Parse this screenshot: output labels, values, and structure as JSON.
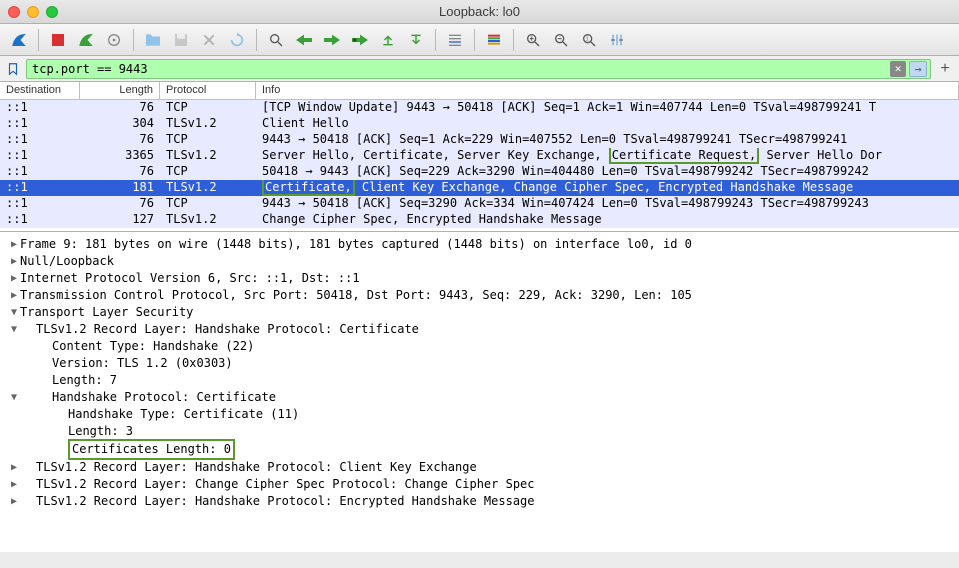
{
  "window": {
    "title": "Loopback: lo0"
  },
  "filter": {
    "value": "tcp.port == 9443"
  },
  "columns": {
    "dest": "Destination",
    "len": "Length",
    "proto": "Protocol",
    "info": "Info"
  },
  "packets": [
    {
      "dest": "::1",
      "len": "76",
      "proto": "TCP",
      "cls": "r-tcp",
      "info": "[TCP Window Update] 9443 → 50418 [ACK] Seq=1 Ack=1 Win=407744 Len=0 TSval=498799241 T"
    },
    {
      "dest": "::1",
      "len": "304",
      "proto": "TLSv1.2",
      "cls": "r-tls",
      "info": "Client Hello"
    },
    {
      "dest": "::1",
      "len": "76",
      "proto": "TCP",
      "cls": "r-tcp",
      "info": "9443 → 50418 [ACK] Seq=1 Ack=229 Win=407552 Len=0 TSval=498799241 TSecr=498799241"
    },
    {
      "dest": "::1",
      "len": "3365",
      "proto": "TLSv1.2",
      "cls": "r-tls",
      "info_parts": [
        "Server Hello, Certificate, Server Key Exchange, ",
        "Certificate Request,",
        " Server Hello Dor"
      ]
    },
    {
      "dest": "::1",
      "len": "76",
      "proto": "TCP",
      "cls": "r-tcp",
      "info": "50418 → 9443 [ACK] Seq=229 Ack=3290 Win=404480 Len=0 TSval=498799242 TSecr=498799242"
    },
    {
      "dest": "::1",
      "len": "181",
      "proto": "TLSv1.2",
      "cls": "r-sel",
      "info_parts": [
        "Certificate,",
        " Client Key Exchange, Change Cipher Spec, Encrypted Handshake Message"
      ]
    },
    {
      "dest": "::1",
      "len": "76",
      "proto": "TCP",
      "cls": "r-tls",
      "info": "9443 → 50418 [ACK] Seq=3290 Ack=334 Win=407424 Len=0 TSval=498799243 TSecr=498799243"
    },
    {
      "dest": "::1",
      "len": "127",
      "proto": "TLSv1.2",
      "cls": "r-tls",
      "info": "Change Cipher Spec, Encrypted Handshake Message"
    }
  ],
  "tree": [
    {
      "caret": ">",
      "indent": 0,
      "text": "Frame 9: 181 bytes on wire (1448 bits), 181 bytes captured (1448 bits) on interface lo0, id 0"
    },
    {
      "caret": ">",
      "indent": 0,
      "text": "Null/Loopback"
    },
    {
      "caret": ">",
      "indent": 0,
      "text": "Internet Protocol Version 6, Src: ::1, Dst: ::1"
    },
    {
      "caret": ">",
      "indent": 0,
      "text": "Transmission Control Protocol, Src Port: 50418, Dst Port: 9443, Seq: 229, Ack: 3290, Len: 105"
    },
    {
      "caret": "v",
      "indent": 0,
      "text": "Transport Layer Security"
    },
    {
      "caret": "v",
      "indent": 1,
      "text": "TLSv1.2 Record Layer: Handshake Protocol: Certificate"
    },
    {
      "caret": "",
      "indent": 2,
      "text": "Content Type: Handshake (22)"
    },
    {
      "caret": "",
      "indent": 2,
      "text": "Version: TLS 1.2 (0x0303)"
    },
    {
      "caret": "",
      "indent": 2,
      "text": "Length: 7"
    },
    {
      "caret": "v",
      "indent": 2,
      "text": "Handshake Protocol: Certificate"
    },
    {
      "caret": "",
      "indent": 3,
      "text": "Handshake Type: Certificate (11)"
    },
    {
      "caret": "",
      "indent": 3,
      "text": "Length: 3"
    },
    {
      "caret": "",
      "indent": 3,
      "text": "Certificates Length: 0",
      "hl": true
    },
    {
      "caret": ">",
      "indent": 1,
      "text": "TLSv1.2 Record Layer: Handshake Protocol: Client Key Exchange"
    },
    {
      "caret": ">",
      "indent": 1,
      "text": "TLSv1.2 Record Layer: Change Cipher Spec Protocol: Change Cipher Spec"
    },
    {
      "caret": ">",
      "indent": 1,
      "text": "TLSv1.2 Record Layer: Handshake Protocol: Encrypted Handshake Message"
    }
  ]
}
